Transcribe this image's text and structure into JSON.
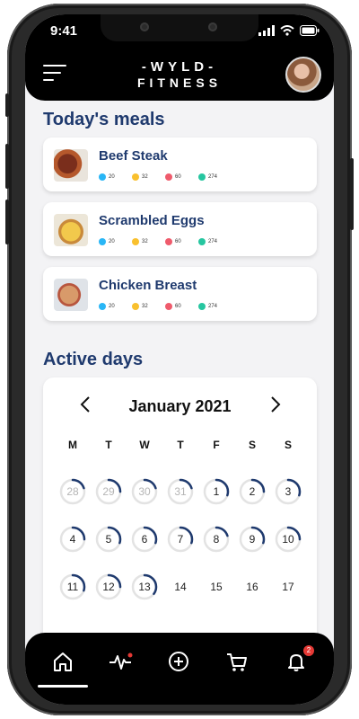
{
  "status": {
    "time": "9:41"
  },
  "brand": {
    "line1": "-WYLD-",
    "line2": "FITNESS"
  },
  "meals_section": {
    "title": "Today's meals"
  },
  "meals": [
    {
      "name": "Beef Steak",
      "thumb": "beef-steak-photo",
      "macros": [
        "20",
        "32",
        "60",
        "274"
      ]
    },
    {
      "name": "Scrambled Eggs",
      "thumb": "scrambled-eggs-photo",
      "macros": [
        "20",
        "32",
        "60",
        "274"
      ]
    },
    {
      "name": "Chicken Breast",
      "thumb": "chicken-breast-photo",
      "macros": [
        "20",
        "32",
        "60",
        "274"
      ]
    }
  ],
  "macro_colors": [
    "#29b6f6",
    "#f9c02e",
    "#ef5b6c",
    "#26c6a0"
  ],
  "active_section": {
    "title": "Active days"
  },
  "calendar": {
    "month_label": "January 2021",
    "prev_icon": "chevron-left-icon",
    "next_icon": "chevron-right-icon",
    "weekdays": [
      "M",
      "T",
      "W",
      "T",
      "F",
      "S",
      "S"
    ],
    "rows": [
      [
        {
          "d": "28",
          "prev": true,
          "p": 0.2
        },
        {
          "d": "29",
          "prev": true,
          "p": 0.25
        },
        {
          "d": "30",
          "prev": true,
          "p": 0.2
        },
        {
          "d": "31",
          "prev": true,
          "p": 0.2
        },
        {
          "d": "1",
          "p": 0.3
        },
        {
          "d": "2",
          "p": 0.25
        },
        {
          "d": "3",
          "p": 0.3
        }
      ],
      [
        {
          "d": "4",
          "p": 0.25
        },
        {
          "d": "5",
          "p": 0.3
        },
        {
          "d": "6",
          "p": 0.3
        },
        {
          "d": "7",
          "p": 0.3
        },
        {
          "d": "8",
          "p": 0.2
        },
        {
          "d": "9",
          "p": 0.3
        },
        {
          "d": "10",
          "p": 0.25
        }
      ],
      [
        {
          "d": "11",
          "p": 0.3
        },
        {
          "d": "12",
          "p": 0.25
        },
        {
          "d": "13",
          "p": 0.35
        },
        {
          "d": "14"
        },
        {
          "d": "15"
        },
        {
          "d": "16"
        },
        {
          "d": "17"
        }
      ]
    ],
    "accent": "#1f3a6e",
    "ring_track": "#e3e3e3"
  },
  "bottom_nav": {
    "items": [
      "home-icon",
      "activity-icon",
      "add-icon",
      "cart-icon",
      "bell-icon"
    ],
    "notification_count": "2"
  }
}
